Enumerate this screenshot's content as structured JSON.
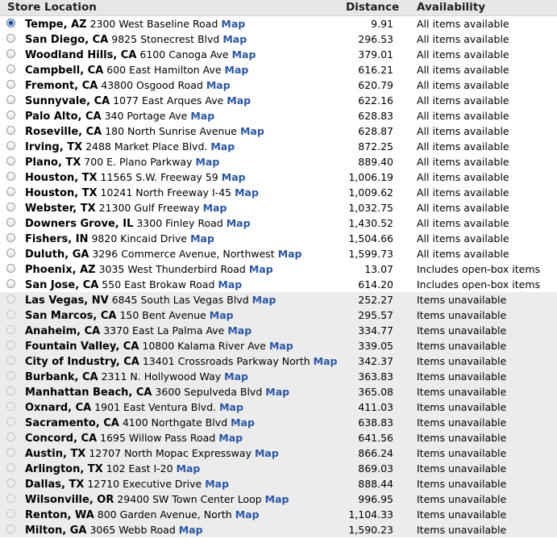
{
  "header": {
    "location": "Store Location",
    "distance": "Distance",
    "availability": "Availability"
  },
  "map_label": "Map",
  "stores": [
    {
      "city": "Tempe, AZ",
      "address": "2300 West Baseline Road",
      "distance": "9.91",
      "availability": "All items available",
      "status": "available",
      "selected": true
    },
    {
      "city": "San Diego, CA",
      "address": "9825 Stonecrest Blvd",
      "distance": "296.53",
      "availability": "All items available",
      "status": "available",
      "selected": false
    },
    {
      "city": "Woodland Hills, CA",
      "address": "6100 Canoga Ave",
      "distance": "379.01",
      "availability": "All items available",
      "status": "available",
      "selected": false
    },
    {
      "city": "Campbell, CA",
      "address": "600 East Hamilton Ave",
      "distance": "616.21",
      "availability": "All items available",
      "status": "available",
      "selected": false
    },
    {
      "city": "Fremont, CA",
      "address": "43800 Osgood Road",
      "distance": "620.79",
      "availability": "All items available",
      "status": "available",
      "selected": false
    },
    {
      "city": "Sunnyvale, CA",
      "address": "1077 East Arques Ave",
      "distance": "622.16",
      "availability": "All items available",
      "status": "available",
      "selected": false
    },
    {
      "city": "Palo Alto, CA",
      "address": "340 Portage Ave",
      "distance": "628.83",
      "availability": "All items available",
      "status": "available",
      "selected": false
    },
    {
      "city": "Roseville, CA",
      "address": "180 North Sunrise Avenue",
      "distance": "628.87",
      "availability": "All items available",
      "status": "available",
      "selected": false
    },
    {
      "city": "Irving, TX",
      "address": "2488 Market Place Blvd.",
      "distance": "872.25",
      "availability": "All items available",
      "status": "available",
      "selected": false
    },
    {
      "city": "Plano, TX",
      "address": "700 E. Plano Parkway",
      "distance": "889.40",
      "availability": "All items available",
      "status": "available",
      "selected": false
    },
    {
      "city": "Houston, TX",
      "address": "11565 S.W. Freeway 59",
      "distance": "1,006.19",
      "availability": "All items available",
      "status": "available",
      "selected": false
    },
    {
      "city": "Houston, TX",
      "address": "10241 North Freeway I-45",
      "distance": "1,009.62",
      "availability": "All items available",
      "status": "available",
      "selected": false
    },
    {
      "city": "Webster, TX",
      "address": "21300 Gulf Freeway",
      "distance": "1,032.75",
      "availability": "All items available",
      "status": "available",
      "selected": false
    },
    {
      "city": "Downers Grove, IL",
      "address": "3300 Finley Road",
      "distance": "1,430.52",
      "availability": "All items available",
      "status": "available",
      "selected": false
    },
    {
      "city": "Fishers, IN",
      "address": "9820 Kincaid Drive",
      "distance": "1,504.66",
      "availability": "All items available",
      "status": "available",
      "selected": false
    },
    {
      "city": "Duluth, GA",
      "address": "3296 Commerce Avenue, Northwest",
      "distance": "1,599.73",
      "availability": "All items available",
      "status": "available",
      "selected": false
    },
    {
      "city": "Phoenix, AZ",
      "address": "3035 West Thunderbird Road",
      "distance": "13.07",
      "availability": "Includes open-box items",
      "status": "openbox",
      "selected": false
    },
    {
      "city": "San Jose, CA",
      "address": "550 East Brokaw Road",
      "distance": "614.20",
      "availability": "Includes open-box items",
      "status": "openbox",
      "selected": false
    },
    {
      "city": "Las Vegas, NV",
      "address": "6845 South Las Vegas Blvd",
      "distance": "252.27",
      "availability": "Items unavailable",
      "status": "unavailable",
      "selected": false
    },
    {
      "city": "San Marcos, CA",
      "address": "150 Bent Avenue",
      "distance": "295.57",
      "availability": "Items unavailable",
      "status": "unavailable",
      "selected": false
    },
    {
      "city": "Anaheim, CA",
      "address": "3370 East La Palma Ave",
      "distance": "334.77",
      "availability": "Items unavailable",
      "status": "unavailable",
      "selected": false
    },
    {
      "city": "Fountain Valley, CA",
      "address": "10800 Kalama River Ave",
      "distance": "339.05",
      "availability": "Items unavailable",
      "status": "unavailable",
      "selected": false
    },
    {
      "city": "City of Industry, CA",
      "address": "13401 Crossroads Parkway North",
      "distance": "342.37",
      "availability": "Items unavailable",
      "status": "unavailable",
      "selected": false
    },
    {
      "city": "Burbank, CA",
      "address": "2311 N. Hollywood Way",
      "distance": "363.83",
      "availability": "Items unavailable",
      "status": "unavailable",
      "selected": false
    },
    {
      "city": "Manhattan Beach, CA",
      "address": "3600 Sepulveda Blvd",
      "distance": "365.08",
      "availability": "Items unavailable",
      "status": "unavailable",
      "selected": false
    },
    {
      "city": "Oxnard, CA",
      "address": "1901 East Ventura Blvd.",
      "distance": "411.03",
      "availability": "Items unavailable",
      "status": "unavailable",
      "selected": false
    },
    {
      "city": "Sacramento, CA",
      "address": "4100 Northgate Blvd",
      "distance": "638.83",
      "availability": "Items unavailable",
      "status": "unavailable",
      "selected": false
    },
    {
      "city": "Concord, CA",
      "address": "1695 Willow Pass Road",
      "distance": "641.56",
      "availability": "Items unavailable",
      "status": "unavailable",
      "selected": false
    },
    {
      "city": "Austin, TX",
      "address": "12707 North Mopac Expressway",
      "distance": "866.24",
      "availability": "Items unavailable",
      "status": "unavailable",
      "selected": false
    },
    {
      "city": "Arlington, TX",
      "address": "102 East I-20",
      "distance": "869.03",
      "availability": "Items unavailable",
      "status": "unavailable",
      "selected": false
    },
    {
      "city": "Dallas, TX",
      "address": "12710 Executive Drive",
      "distance": "888.44",
      "availability": "Items unavailable",
      "status": "unavailable",
      "selected": false
    },
    {
      "city": "Wilsonville, OR",
      "address": "29400 SW Town Center Loop",
      "distance": "996.95",
      "availability": "Items unavailable",
      "status": "unavailable",
      "selected": false
    },
    {
      "city": "Renton, WA",
      "address": "800 Garden Avenue, North",
      "distance": "1,104.33",
      "availability": "Items unavailable",
      "status": "unavailable",
      "selected": false
    },
    {
      "city": "Milton, GA",
      "address": "3065 Webb Road",
      "distance": "1,590.23",
      "availability": "Items unavailable",
      "status": "unavailable",
      "selected": false
    }
  ]
}
